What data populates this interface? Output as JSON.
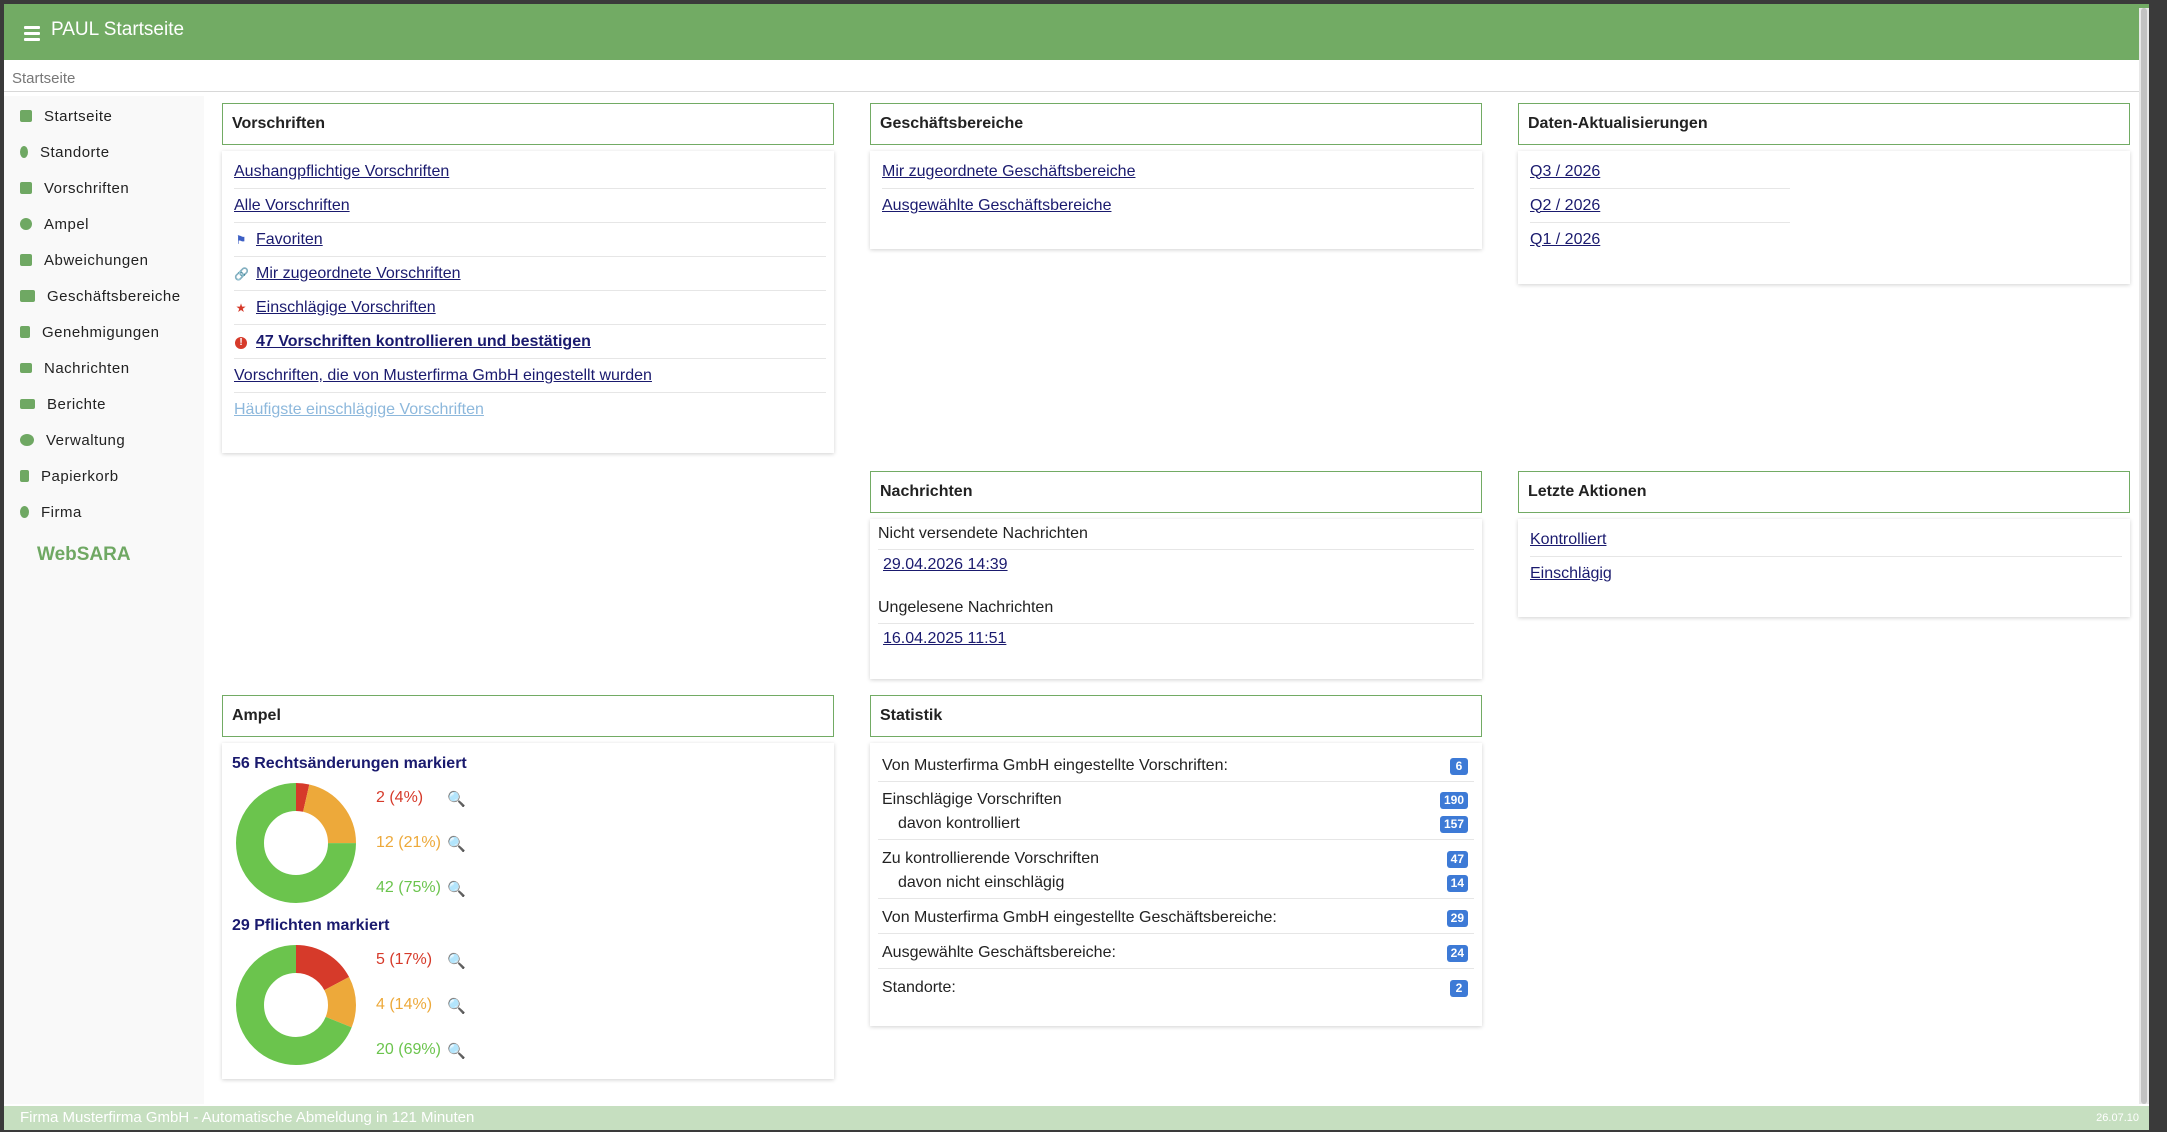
{
  "header": {
    "title": "PAUL Startseite"
  },
  "breadcrumb": "Startseite",
  "sidebar": {
    "items": [
      {
        "label": "Startseite",
        "icon": "home-icon"
      },
      {
        "label": "Standorte",
        "icon": "map-marker-icon"
      },
      {
        "label": "Vorschriften",
        "icon": "book-icon"
      },
      {
        "label": "Ampel",
        "icon": "circle-icon"
      },
      {
        "label": "Abweichungen",
        "icon": "note-icon"
      },
      {
        "label": "Geschäftsbereiche",
        "icon": "tags-icon"
      },
      {
        "label": "Genehmigungen",
        "icon": "file-icon"
      },
      {
        "label": "Nachrichten",
        "icon": "envelope-icon"
      },
      {
        "label": "Berichte",
        "icon": "area-chart-icon"
      },
      {
        "label": "Verwaltung",
        "icon": "cogs-icon"
      },
      {
        "label": "Papierkorb",
        "icon": "trash-icon"
      },
      {
        "label": "Firma",
        "icon": "user-icon"
      }
    ],
    "brand": "WebSARA"
  },
  "vorschriften": {
    "title": "Vorschriften",
    "items": [
      {
        "label": "Aushangpflichtige Vorschriften"
      },
      {
        "label": "Alle Vorschriften"
      },
      {
        "label": "Favoriten",
        "icon": "bookmark-icon"
      },
      {
        "label": "Mir zugeordnete Vorschriften",
        "icon": "link-icon"
      },
      {
        "label": "Einschlägige Vorschriften",
        "icon": "star-icon"
      },
      {
        "label": "47 Vorschriften kontrollieren und bestätigen",
        "icon": "exclamation-circle-icon"
      },
      {
        "label": "Vorschriften, die von Musterfirma GmbH eingestellt wurden"
      },
      {
        "label": "Häufigste einschlägige Vorschriften"
      }
    ]
  },
  "geschaeftsbereiche": {
    "title": "Geschäftsbereiche",
    "items": [
      {
        "label": "Mir zugeordnete Geschäftsbereiche"
      },
      {
        "label": "Ausgewählte Geschäftsbereiche"
      }
    ]
  },
  "updates": {
    "title": "Daten-Aktualisierungen",
    "items": [
      {
        "label": "Q3 / 2026"
      },
      {
        "label": "Q2 / 2026"
      },
      {
        "label": "Q1 / 2026"
      }
    ]
  },
  "nachrichten": {
    "title": "Nachrichten",
    "unsent_label": "Nicht versendete Nachrichten",
    "unsent_date": "29.04.2026 14:39",
    "unread_label": "Ungelesene Nachrichten",
    "unread_date": "16.04.2025 11:51"
  },
  "aktionen": {
    "title": "Letzte Aktionen",
    "items": [
      {
        "label": "Kontrolliert"
      },
      {
        "label": "Einschlägig"
      }
    ]
  },
  "ampel": {
    "title": "Ampel",
    "groups": [
      {
        "heading": "56 Rechtsänderungen markiert",
        "segments": [
          {
            "label": "2 (4%)",
            "value": 2,
            "color": "#d63a2a"
          },
          {
            "label": "12 (21%)",
            "value": 12,
            "color": "#eda93a"
          },
          {
            "label": "42 (75%)",
            "value": 42,
            "color": "#6bc44d"
          }
        ]
      },
      {
        "heading": "29 Pflichten markiert",
        "segments": [
          {
            "label": "5 (17%)",
            "value": 5,
            "color": "#d63a2a"
          },
          {
            "label": "4 (14%)",
            "value": 4,
            "color": "#eda93a"
          },
          {
            "label": "20 (69%)",
            "value": 20,
            "color": "#6bc44d"
          }
        ]
      }
    ]
  },
  "statistik": {
    "title": "Statistik",
    "rows": [
      {
        "lines": [
          {
            "label": "Von Musterfirma GmbH eingestellte Vorschriften:",
            "value": "6"
          }
        ]
      },
      {
        "lines": [
          {
            "label": "Einschlägige Vorschriften",
            "value": "190"
          },
          {
            "label": "davon kontrolliert",
            "value": "157",
            "sub": true
          }
        ]
      },
      {
        "lines": [
          {
            "label": "Zu kontrollierende Vorschriften",
            "value": "47"
          },
          {
            "label": "davon nicht einschlägig",
            "value": "14",
            "sub": true
          }
        ]
      },
      {
        "lines": [
          {
            "label": "Von Musterfirma GmbH eingestellte Geschäftsbereiche:",
            "value": "29"
          }
        ]
      },
      {
        "lines": [
          {
            "label": "Ausgewählte Geschäftsbereiche:",
            "value": "24"
          }
        ]
      },
      {
        "lines": [
          {
            "label": "Standorte:",
            "value": "2"
          }
        ]
      }
    ]
  },
  "footer": {
    "text": "Firma Musterfirma GmbH - Automatische Abmeldung in 121 Minuten",
    "version": "26.07.10"
  },
  "colors": {
    "brand": "#72ab64",
    "link": "#1a1a6e",
    "badge": "#3d7ad6"
  }
}
